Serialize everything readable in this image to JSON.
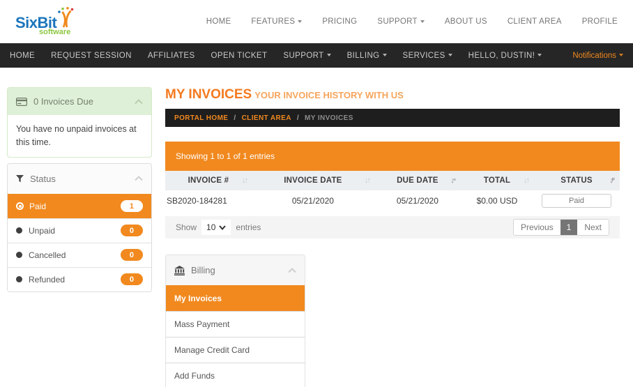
{
  "brand": {
    "name": "SixBit",
    "tagline": "software"
  },
  "top_nav": {
    "items": [
      {
        "label": "HOME"
      },
      {
        "label": "FEATURES"
      },
      {
        "label": "PRICING"
      },
      {
        "label": "SUPPORT"
      },
      {
        "label": "ABOUT US"
      },
      {
        "label": "CLIENT AREA"
      },
      {
        "label": "PROFILE"
      }
    ]
  },
  "secondary_nav": {
    "items": [
      {
        "label": "HOME"
      },
      {
        "label": "REQUEST SESSION"
      },
      {
        "label": "AFFILIATES"
      },
      {
        "label": "OPEN TICKET"
      },
      {
        "label": "SUPPORT"
      },
      {
        "label": "BILLING"
      },
      {
        "label": "SERVICES"
      },
      {
        "label": "HELLO, DUSTIN!"
      }
    ],
    "notifications_label": "Notifications"
  },
  "sidebar": {
    "invoices_due": {
      "title": "0 Invoices Due",
      "body": "You have no unpaid invoices at this time."
    },
    "status": {
      "title": "Status",
      "items": [
        {
          "label": "Paid",
          "count": "1"
        },
        {
          "label": "Unpaid",
          "count": "0"
        },
        {
          "label": "Cancelled",
          "count": "0"
        },
        {
          "label": "Refunded",
          "count": "0"
        }
      ]
    }
  },
  "main": {
    "title": "MY INVOICES",
    "subtitle": "YOUR INVOICE HISTORY WITH US",
    "breadcrumb": {
      "separator": "/",
      "items": [
        {
          "label": "PORTAL HOME"
        },
        {
          "label": "CLIENT AREA"
        },
        {
          "label": "MY INVOICES"
        }
      ]
    },
    "showing_text": "Showing 1 to 1 of 1 entries",
    "invoice_table": {
      "columns": [
        {
          "label": "INVOICE #",
          "sort": "updown"
        },
        {
          "label": "INVOICE DATE",
          "sort": "updown"
        },
        {
          "label": "DUE DATE",
          "sort": "amount-active"
        },
        {
          "label": "TOTAL",
          "sort": "updown"
        },
        {
          "label": "STATUS",
          "sort": "alpha-active"
        }
      ],
      "rows": [
        {
          "invoice": "SB2020-184281",
          "invoice_date": "05/21/2020",
          "due_date": "05/21/2020",
          "total": "$0.00 USD",
          "status": "Paid"
        }
      ]
    },
    "pagination": {
      "show_label": "Show",
      "page_size": "10",
      "entries_label": "entries",
      "previous_label": "Previous",
      "current_page": "1",
      "next_label": "Next"
    },
    "billing_menu": {
      "title": "Billing",
      "items": [
        {
          "label": "My Invoices"
        },
        {
          "label": "Mass Payment"
        },
        {
          "label": "Manage Credit Card"
        },
        {
          "label": "Add Funds"
        }
      ]
    }
  },
  "colors": {
    "accent_orange": "#F1891F",
    "dark_nav_bg": "#262626",
    "breadcrumb_bg": "#1E1E1E",
    "success_panel_bg": "#DFF0D8",
    "table_header_bg": "#ECEFF1",
    "pagination_bg": "#F4F4F4",
    "logo_blue": "#1C75BC",
    "logo_green": "#8DC63F"
  }
}
